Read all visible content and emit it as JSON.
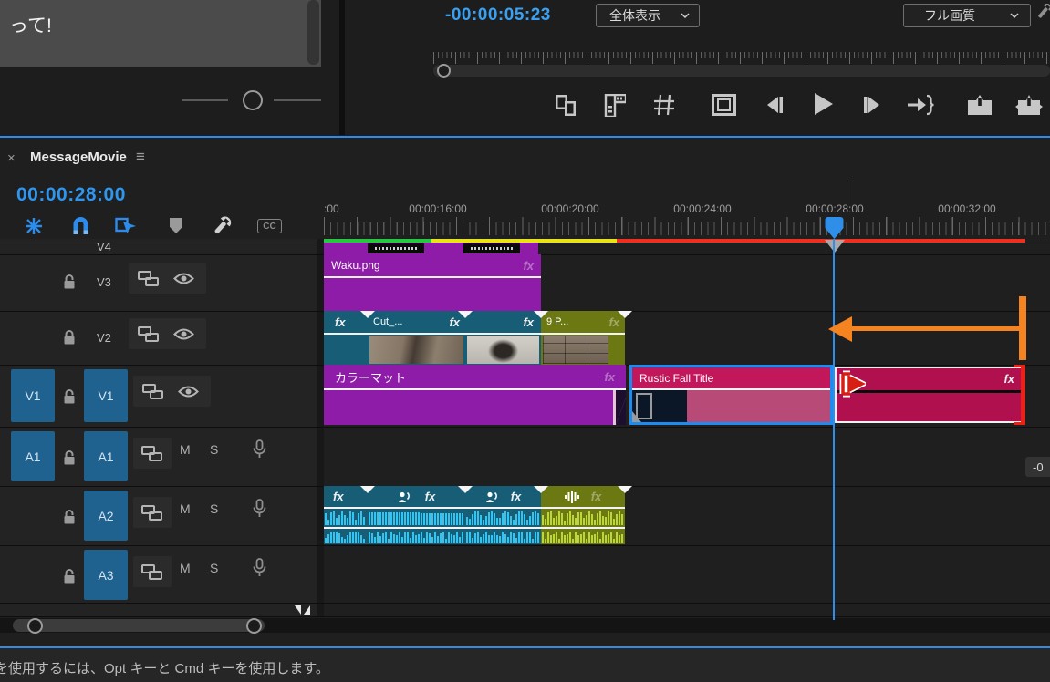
{
  "left_monitor": {
    "caption": "って!"
  },
  "program_monitor": {
    "timecode": "-00:00:05:23",
    "fit_dropdown": {
      "value": "全体表示"
    },
    "quality_dropdown": {
      "value": "フル画質"
    },
    "transport_icons": [
      "filmstrip",
      "corner-ruler",
      "grid",
      "safe-margins",
      "step-back",
      "play",
      "step-forward",
      "go-to-out",
      "lift",
      "extract"
    ]
  },
  "timeline": {
    "tab": {
      "close": "×",
      "title": "MessageMovie",
      "menu": "≡"
    },
    "timecode": "00:00:28:00",
    "labels": {
      "fx": "fx",
      "mute": "M",
      "solo": "S",
      "captions": "CC"
    },
    "ruler": {
      "ticks": [
        ":00",
        "00:00:16:00",
        "00:00:20:00",
        "00:00:24:00",
        "00:00:28:00",
        "00:00:32:00"
      ]
    },
    "tracks": {
      "v4": {
        "name": "V4"
      },
      "v3": {
        "name": "V3",
        "clips": [
          {
            "label": "Waku.png"
          }
        ]
      },
      "v2": {
        "name": "V2",
        "clips": [
          {
            "label": ""
          },
          {
            "label": "Cut_..."
          },
          {
            "label": ""
          },
          {
            "label": "9 P..."
          }
        ]
      },
      "v1": {
        "name": "V1",
        "source_patch": "V1",
        "clips": [
          {
            "label": "カラーマット"
          },
          {
            "label": "Rustic Fall Title"
          },
          {
            "label": ""
          }
        ]
      },
      "a1": {
        "name": "A1",
        "source_patch": "A1"
      },
      "a2": {
        "name": "A2"
      },
      "a3": {
        "name": "A3"
      }
    },
    "trim_tooltip": "-0",
    "colors": {
      "selection_blue": "#1d8cf0",
      "render_green": "#25c93f",
      "render_yellow": "#e8e416",
      "render_red": "#ef2f1f",
      "annotation_orange": "#f5831f",
      "clip_purple": "#8e1ca8",
      "clip_teal": "#175d76",
      "clip_olive": "#6c7913",
      "clip_crimson": "#c2175b",
      "waveform_cyan": "#33c4f2",
      "waveform_olive": "#bdd63a"
    }
  },
  "status_bar": {
    "text": "を使用するには、Opt キーと Cmd キーを使用します。"
  }
}
